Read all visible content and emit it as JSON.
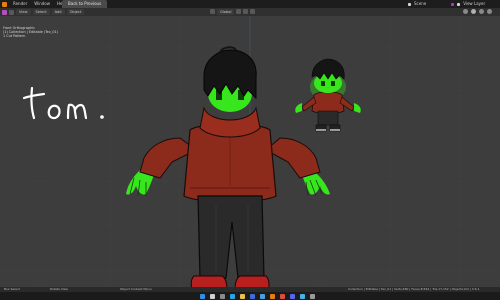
{
  "top_menu": {
    "items": [
      "Render",
      "Window",
      "Help"
    ],
    "active_tab": "Back to Previous",
    "scene_label": "Scene",
    "view_layer_label": "View Layer"
  },
  "header": {
    "buttons": [
      "View",
      "Select",
      "Add",
      "Object"
    ],
    "orientation_label": "Global"
  },
  "viewport": {
    "overlay_lines": [
      "Front Orthographic",
      "(1) Collection | Editable (Tex_01)",
      "1 Cut Pattern"
    ],
    "handwritten_text": "tom.",
    "colors": {
      "glow": "#37e61c",
      "sweater": "#8c2a1c",
      "pants": "#2a2a2a",
      "shoes": "#b82020",
      "hair": "#151515"
    }
  },
  "status_bar": {
    "left_items": [
      "Box Select",
      "Rotate View",
      "Object Context Menu"
    ],
    "right_text": "Collection | Editable | Tex_01 | Verts:480 | Faces:8,564 | Tris:17,152 | Objects:0/4 | 3.6.1"
  },
  "taskbar": {
    "icons": [
      "windows-icon",
      "search-icon",
      "task-view-icon",
      "edge-icon",
      "explorer-icon",
      "store-icon",
      "mail-icon",
      "blender-icon",
      "chrome-icon",
      "discord-icon",
      "photos-icon",
      "settings-icon"
    ],
    "weather": "",
    "time": ""
  }
}
